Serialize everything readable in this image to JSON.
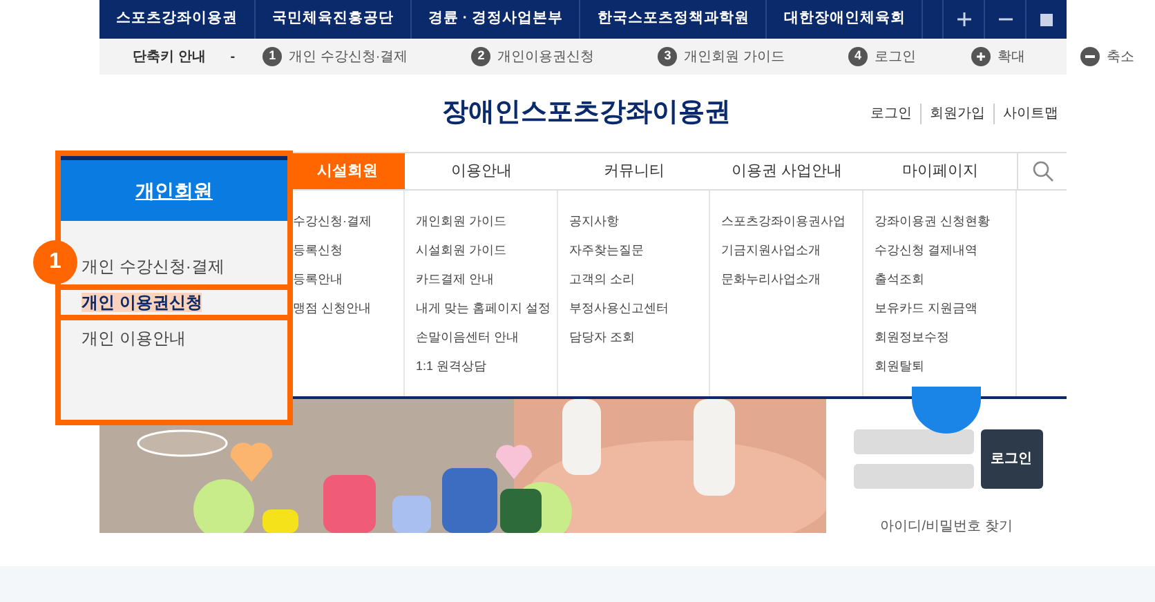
{
  "top_links": [
    "스포츠강좌이용권",
    "국민체육진흥공단",
    "경륜 · 경정사업본부",
    "한국스포츠정책과학원",
    "대한장애인체육회"
  ],
  "shortcut_bar": {
    "title": "단축키 안내",
    "separator": "-",
    "items": [
      {
        "kind": "number",
        "key": "1",
        "label": "개인 수강신청·결제"
      },
      {
        "kind": "number",
        "key": "2",
        "label": "개인이용권신청"
      },
      {
        "kind": "number",
        "key": "3",
        "label": "개인회원 가이드"
      },
      {
        "kind": "number",
        "key": "4",
        "label": "로그인"
      },
      {
        "kind": "zoom_in",
        "label": "확대"
      },
      {
        "kind": "zoom_out",
        "label": "축소"
      }
    ]
  },
  "header": {
    "logo": "장애인스포츠강좌이용권",
    "links": [
      "로그인",
      "회원가입",
      "사이트맵"
    ]
  },
  "nav": [
    {
      "label": "시설회원",
      "selected": true,
      "menu": [
        "수강신청·결제",
        "등록신청",
        "등록안내",
        "맹점 신청안내"
      ]
    },
    {
      "label": "이용안내",
      "selected": false,
      "menu": [
        "개인회원 가이드",
        "시설회원 가이드",
        "카드결제 안내",
        "내게 맞는 홈페이지 설정",
        "손말이음센터 안내",
        "1:1 원격상담"
      ]
    },
    {
      "label": "커뮤니티",
      "selected": false,
      "menu": [
        "공지사항",
        "자주찾는질문",
        "고객의 소리",
        "부정사용신고센터",
        "담당자 조회"
      ]
    },
    {
      "label": "이용권 사업안내",
      "selected": false,
      "menu": [
        "스포츠강좌이용권사업",
        "기금지원사업소개",
        "문화누리사업소개"
      ]
    },
    {
      "label": "마이페이지",
      "selected": false,
      "menu": [
        "강좌이용권 신청현황",
        "수강신청 결제내역",
        "출석조회",
        "보유카드 지원금액",
        "회원정보수정",
        "회원탈퇴"
      ]
    }
  ],
  "popup": {
    "title": "개인회원",
    "step_badge": "1",
    "items": [
      {
        "label": "개인 수강신청·결제",
        "selected": false
      },
      {
        "label": "개인 이용권신청",
        "selected": true
      },
      {
        "label": "개인 이용안내",
        "selected": false
      }
    ]
  },
  "banner": {
    "kind": "picture"
  },
  "login": {
    "button": "로그인",
    "find_link": "아이디/비밀번호 찾기"
  }
}
